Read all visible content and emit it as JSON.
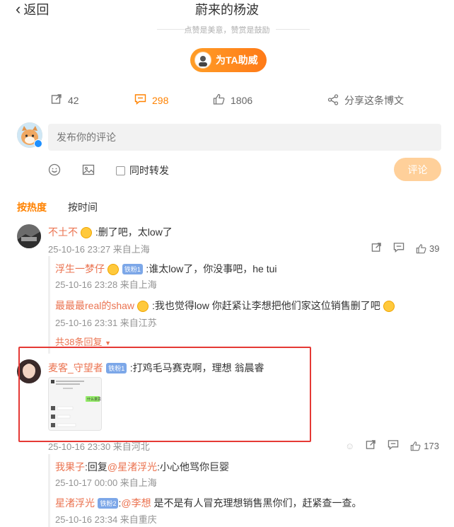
{
  "header": {
    "back_label": "返回",
    "title": "蔚来的杨波",
    "slogan": "点赞是美意，赞赏是鼓励",
    "cheer_button": "为TA助威"
  },
  "actions": {
    "repost_count": "42",
    "comment_count": "298",
    "like_count": "1806",
    "share_label": "分享这条博文"
  },
  "composer": {
    "placeholder": "发布你的评论",
    "repost_checkbox": "同时转发",
    "submit_label": "评论"
  },
  "sort_tabs": {
    "hot": "按热度",
    "time": "按时间"
  },
  "comments": [
    {
      "user": "不土不",
      "text": ":删了吧，太low了",
      "time": "25-10-16 23:27 来自上海",
      "likes": "39",
      "replies": [
        {
          "user": "浮生一梦仔",
          "badge": "铁粉1",
          "text": ":谁太low了，你没事吧，he tui",
          "time": "25-10-16 23:28 来自上海"
        },
        {
          "user": "最最最real的shaw",
          "text": ":我也觉得low 你赶紧让李想把他们家这位销售删了吧",
          "time": "25-10-16 23:31 来自江苏"
        }
      ],
      "more_replies": "共38条回复"
    },
    {
      "user": "麦客_守望者",
      "badge": "铁粉1",
      "text": ":打鸡毛马赛克啊，理想 翁晨睿",
      "time": "25-10-16 23:30 来自河北",
      "likes": "173",
      "replies": [
        {
          "user": "我果子",
          "mention": "@星渚浮光",
          "text_pre": ":回复",
          "text": ":小心他骂你巨婴",
          "time": "25-10-17 00:00 来自上海"
        },
        {
          "user": "星渚浮光",
          "badge": "铁粉2",
          "mention": "@李想",
          "text_pre": ":",
          "text": " 是不是有人冒充理想销售黑你们，赶紧查一查。",
          "time": "25-10-16 23:34 来自重庆"
        }
      ]
    }
  ],
  "screenshot_thumb": {
    "reply_bubble": "什么意思"
  }
}
